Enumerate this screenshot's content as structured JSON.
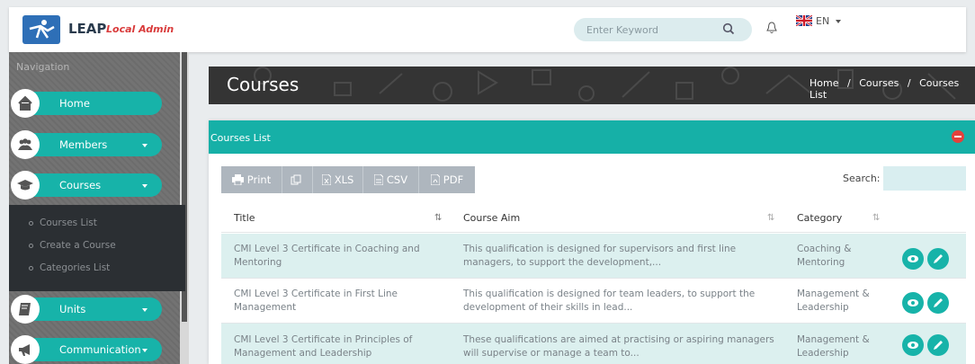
{
  "header": {
    "brand": "LEAP",
    "brand_sub": "Local Admin",
    "search_placeholder": "Enter Keyword",
    "language": "EN"
  },
  "sidebar": {
    "section_label": "Navigation",
    "items": [
      {
        "label": "Home",
        "icon": "home-icon"
      },
      {
        "label": "Members",
        "icon": "members-icon"
      },
      {
        "label": "Courses",
        "icon": "graduation-cap-icon"
      },
      {
        "label": "Units",
        "icon": "book-icon"
      },
      {
        "label": "Communication",
        "icon": "megaphone-icon"
      }
    ],
    "courses_submenu": [
      "Courses List",
      "Create a Course",
      "Categories List"
    ]
  },
  "page": {
    "title": "Courses",
    "breadcrumb": [
      "Home",
      "Courses",
      "Courses List"
    ],
    "breadcrumb_sep": "/"
  },
  "panel": {
    "title": "Courses List",
    "buttons": [
      "Print",
      "",
      "XLS",
      "CSV",
      "PDF"
    ],
    "search_label": "Search:",
    "columns": [
      "Title",
      "Course Aim",
      "Category"
    ],
    "rows": [
      {
        "title": [
          "CMI Level 3 Certificate in Coaching and",
          "Mentoring"
        ],
        "aim": [
          "This qualification is designed for supervisors and first line",
          "managers, to support the development,..."
        ],
        "category": [
          "Coaching &",
          "Mentoring"
        ]
      },
      {
        "title": [
          "CMI Level 3 Certificate in First Line",
          "Management"
        ],
        "aim": [
          "This qualification is designed for team leaders, to support the",
          "development of their skills in lead..."
        ],
        "category": [
          "Management &",
          "Leadership"
        ]
      },
      {
        "title": [
          "CMI Level 3 Certificate in Principles of",
          "Management and Leadership"
        ],
        "aim": [
          "These qualifications are aimed at practising or aspiring managers",
          "will supervise or manage a team to..."
        ],
        "category": [
          "Management &",
          "Leadership"
        ]
      }
    ]
  },
  "colors": {
    "accent": "#17b3a9",
    "danger": "#e3413c",
    "brand_blue": "#2e6fb7"
  }
}
